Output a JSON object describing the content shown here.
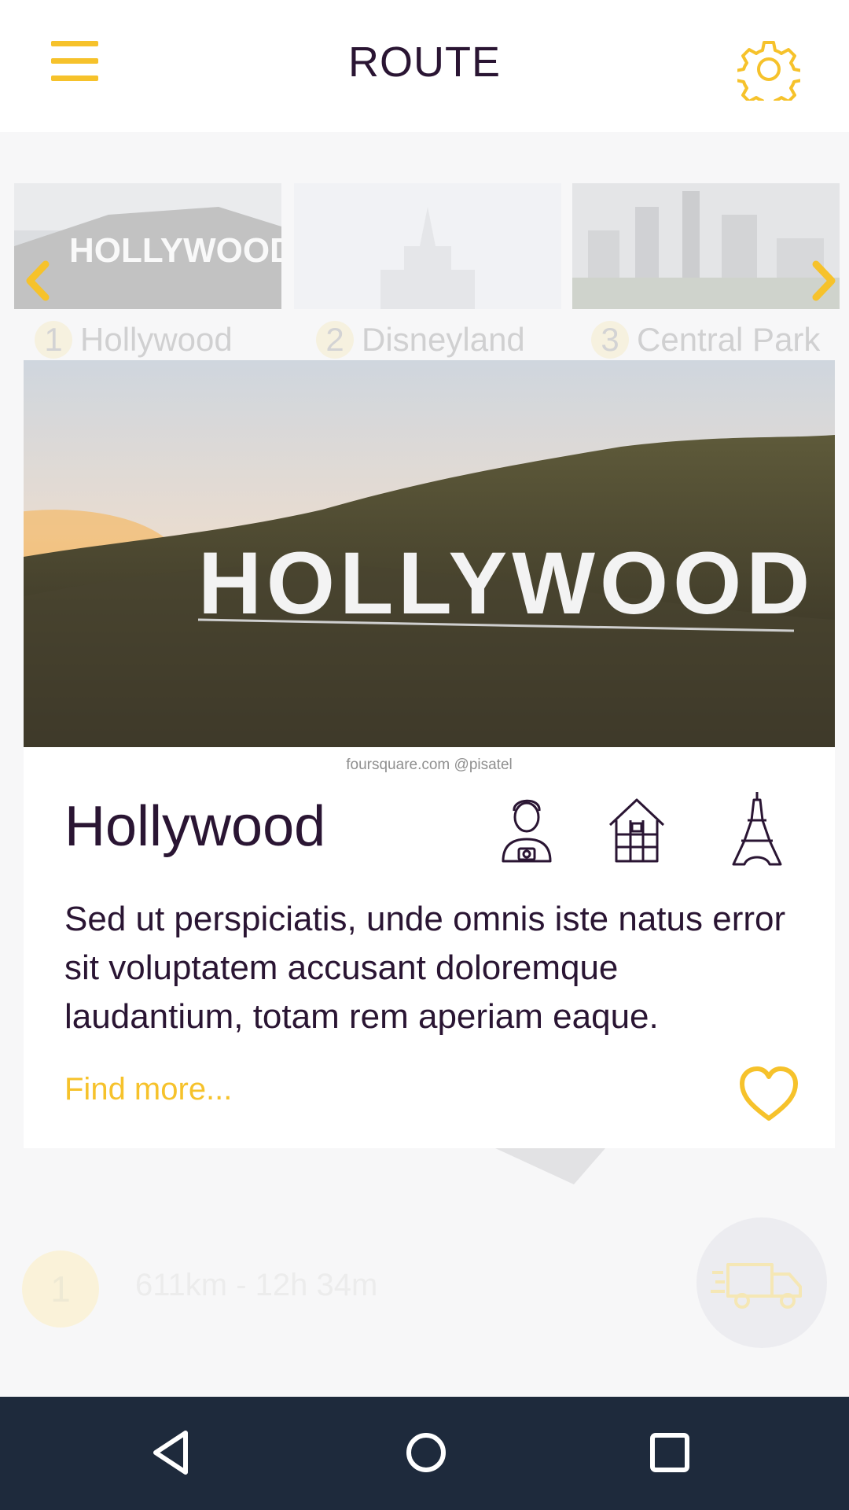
{
  "header": {
    "title": "ROUTE",
    "menu_icon": "hamburger-menu-icon",
    "settings_icon": "gear-icon"
  },
  "carousel": {
    "items": [
      {
        "number": "1",
        "label": "Hollywood",
        "image": "hollywood-sign-thumbnail"
      },
      {
        "number": "2",
        "label": "Disneyland",
        "image": "disneyland-castle-thumbnail"
      },
      {
        "number": "3",
        "label": "Central Park",
        "image": "central-park-skyline-thumbnail"
      }
    ],
    "prev_icon": "chevron-left-icon",
    "next_icon": "chevron-right-icon"
  },
  "card": {
    "photo_text": "HOLLYWOOD",
    "credit": "foursquare.com  @pisatel",
    "name": "Hollywood",
    "category_icons": [
      "photographer-icon",
      "house-icon",
      "eiffel-tower-icon"
    ],
    "description": "Sed ut perspiciatis, unde omnis iste natus error sit voluptatem accusant doloremque laudantium, totam rem aperiam eaque.",
    "link": "Find more...",
    "favorite_icon": "heart-icon"
  },
  "route": {
    "number": "1",
    "summary": "611km - 12h 34m",
    "fab_icon": "truck-icon"
  },
  "navbar": {
    "icons": [
      "back-triangle-icon",
      "home-circle-icon",
      "recents-square-icon"
    ]
  },
  "colors": {
    "accent": "#f6c22b",
    "text": "#2a1533",
    "navbar": "#1e2a3c",
    "background": "#f7f7f8"
  }
}
